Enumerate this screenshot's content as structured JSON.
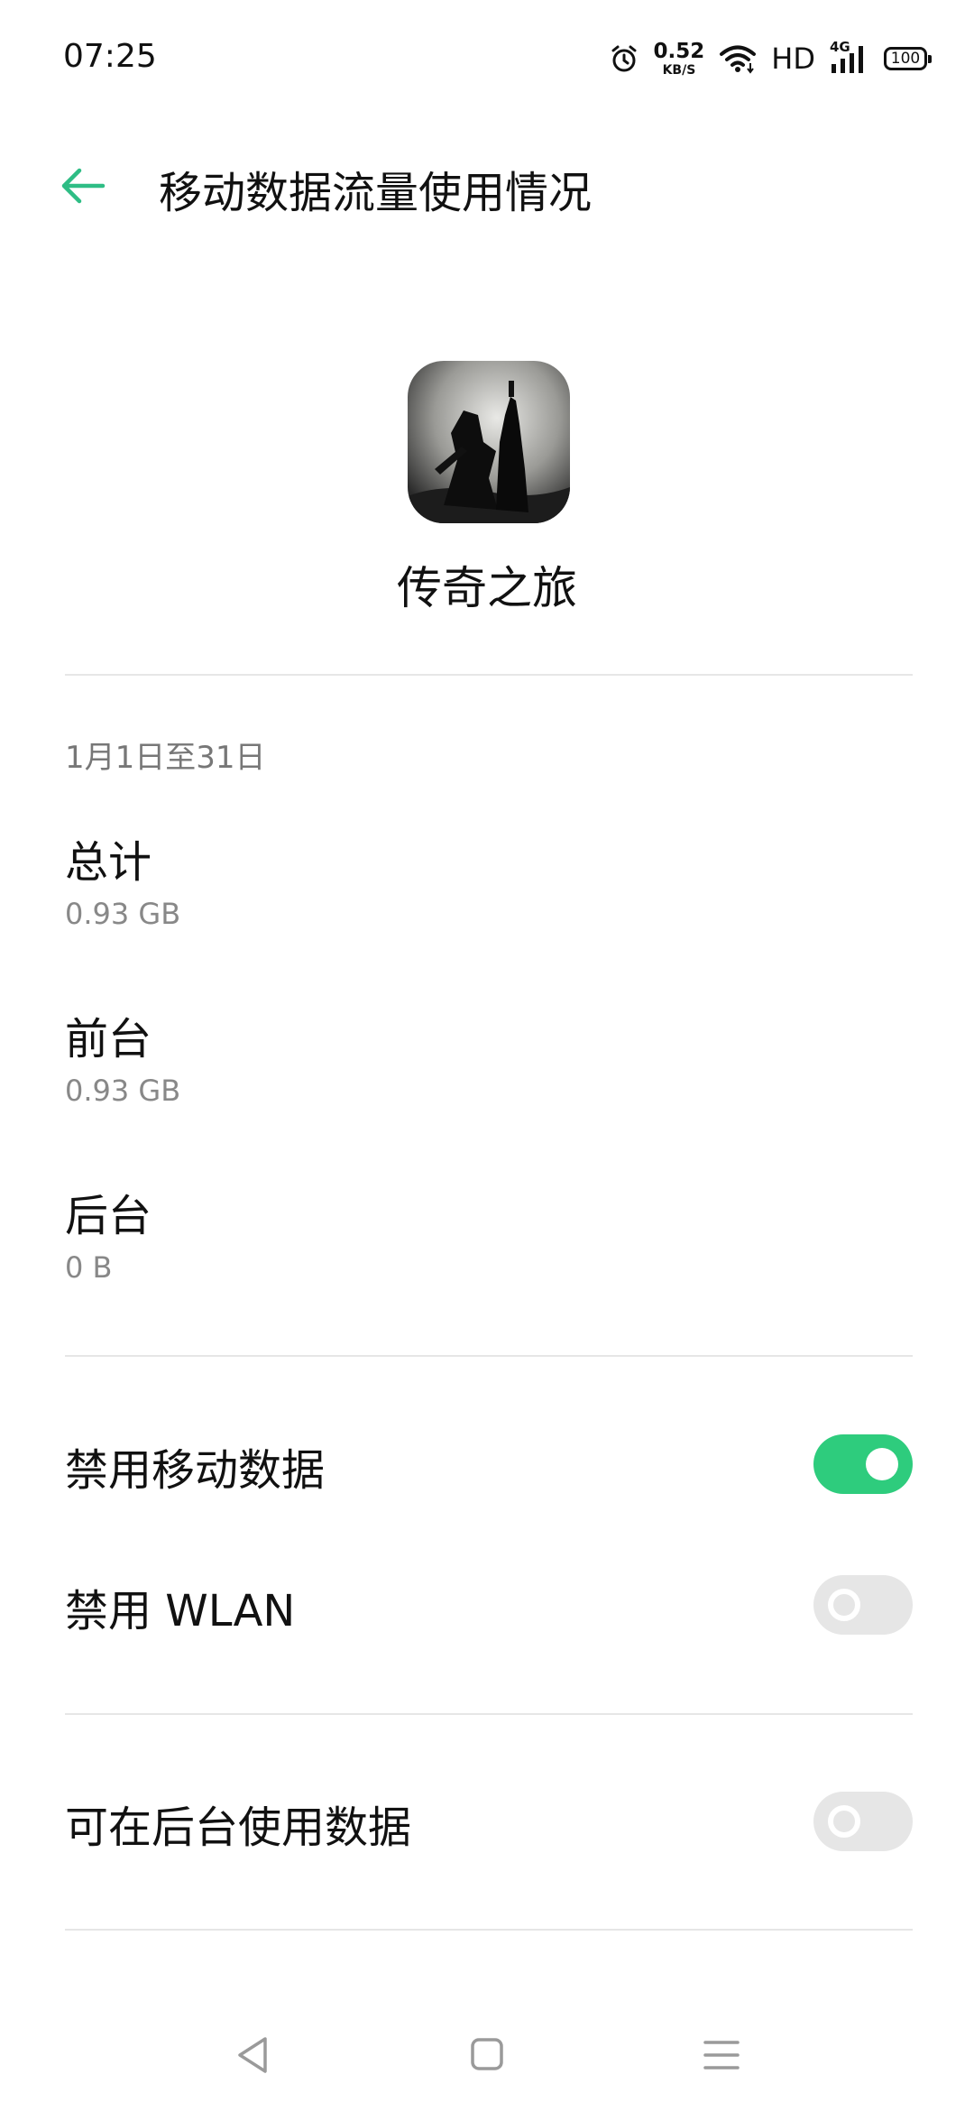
{
  "status_bar": {
    "time": "07:25",
    "net_speed_value": "0.52",
    "net_speed_unit": "KB/S",
    "hd_label": "HD",
    "network_type": "4G",
    "battery_level": "100",
    "icons": [
      "alarm-icon",
      "wifi-icon",
      "signal-icon",
      "battery-icon"
    ]
  },
  "header": {
    "title": "移动数据流量使用情况",
    "back_icon": "arrow-left-icon"
  },
  "app": {
    "name": "传奇之旅"
  },
  "usage": {
    "period": "1月1日至31日",
    "stats": [
      {
        "label": "总计",
        "value": "0.93 GB"
      },
      {
        "label": "前台",
        "value": "0.93 GB"
      },
      {
        "label": "后台",
        "value": "0 B"
      }
    ]
  },
  "settings": {
    "toggles": [
      {
        "label": "禁用移动数据",
        "on": true
      },
      {
        "label": "禁用 WLAN",
        "on": false
      },
      {
        "label": "可在后台使用数据",
        "on": false
      }
    ]
  },
  "nav_bar": {
    "icons": [
      "back-triangle-icon",
      "home-square-icon",
      "menu-lines-icon"
    ]
  },
  "colors": {
    "accent": "#2ecc7d",
    "back_arrow": "#2ebd85",
    "divider": "#e6e6e6",
    "secondary_text": "#888888"
  }
}
